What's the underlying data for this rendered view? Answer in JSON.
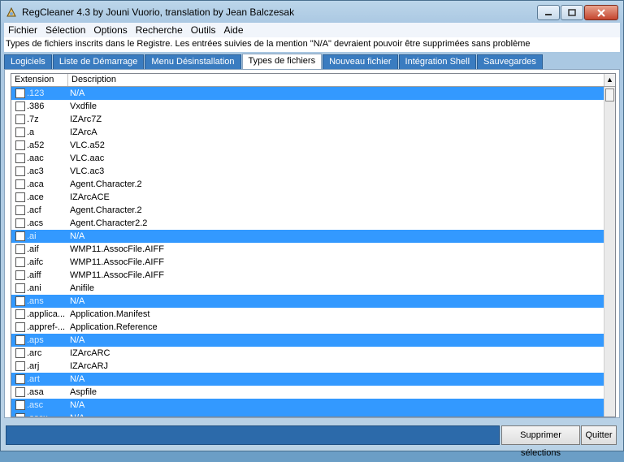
{
  "window": {
    "title": "RegCleaner 4.3 by Jouni Vuorio, translation by Jean Balczesak"
  },
  "menu": [
    "Fichier",
    "Sélection",
    "Options",
    "Recherche",
    "Outils",
    "Aide"
  ],
  "info": "Types de fichiers inscrits dans le Registre. Les entrées suivies de la mention \"N/A\" devraient pouvoir être supprimées sans problème",
  "tabs": [
    "Logiciels",
    "Liste de Démarrage",
    "Menu Désinstallation",
    "Types de fichiers",
    "Nouveau fichier",
    "Intégration Shell",
    "Sauvegardes"
  ],
  "active_tab": "Types de fichiers",
  "columns": {
    "extension": "Extension",
    "description": "Description"
  },
  "rows": [
    {
      "ext": ".123",
      "desc": "N/A",
      "sel": true
    },
    {
      "ext": ".386",
      "desc": "Vxdfile",
      "sel": false
    },
    {
      "ext": ".7z",
      "desc": "IZArc7Z",
      "sel": false
    },
    {
      "ext": ".a",
      "desc": "IZArcA",
      "sel": false
    },
    {
      "ext": ".a52",
      "desc": "VLC.a52",
      "sel": false
    },
    {
      "ext": ".aac",
      "desc": "VLC.aac",
      "sel": false
    },
    {
      "ext": ".ac3",
      "desc": "VLC.ac3",
      "sel": false
    },
    {
      "ext": ".aca",
      "desc": "Agent.Character.2",
      "sel": false
    },
    {
      "ext": ".ace",
      "desc": "IZArcACE",
      "sel": false
    },
    {
      "ext": ".acf",
      "desc": "Agent.Character.2",
      "sel": false
    },
    {
      "ext": ".acs",
      "desc": "Agent.Character2.2",
      "sel": false
    },
    {
      "ext": ".ai",
      "desc": "N/A",
      "sel": true
    },
    {
      "ext": ".aif",
      "desc": "WMP11.AssocFile.AIFF",
      "sel": false
    },
    {
      "ext": ".aifc",
      "desc": "WMP11.AssocFile.AIFF",
      "sel": false
    },
    {
      "ext": ".aiff",
      "desc": "WMP11.AssocFile.AIFF",
      "sel": false
    },
    {
      "ext": ".ani",
      "desc": "Anifile",
      "sel": false
    },
    {
      "ext": ".ans",
      "desc": "N/A",
      "sel": true
    },
    {
      "ext": ".applica...",
      "desc": "Application.Manifest",
      "sel": false
    },
    {
      "ext": ".appref-...",
      "desc": "Application.Reference",
      "sel": false
    },
    {
      "ext": ".aps",
      "desc": "N/A",
      "sel": true
    },
    {
      "ext": ".arc",
      "desc": "IZArcARC",
      "sel": false
    },
    {
      "ext": ".arj",
      "desc": "IZArcARJ",
      "sel": false
    },
    {
      "ext": ".art",
      "desc": "N/A",
      "sel": true
    },
    {
      "ext": ".asa",
      "desc": "Aspfile",
      "sel": false
    },
    {
      "ext": ".asc",
      "desc": "N/A",
      "sel": true
    },
    {
      "ext": ".ascx",
      "desc": "N/A",
      "sel": true
    }
  ],
  "buttons": {
    "delete": "Supprimer sélections",
    "quit": "Quitter"
  }
}
